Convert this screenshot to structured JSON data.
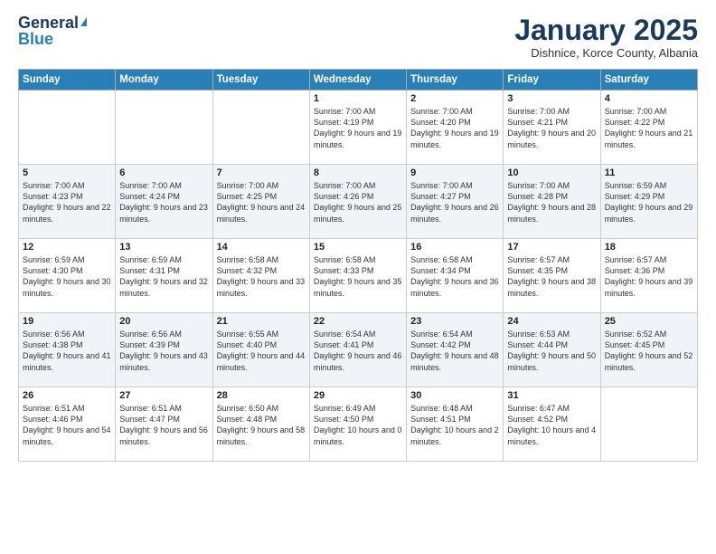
{
  "logo": {
    "general": "General",
    "blue": "Blue"
  },
  "header": {
    "month": "January 2025",
    "location": "Dishnice, Korce County, Albania"
  },
  "weekdays": [
    "Sunday",
    "Monday",
    "Tuesday",
    "Wednesday",
    "Thursday",
    "Friday",
    "Saturday"
  ],
  "weeks": [
    [
      {
        "day": "",
        "sunrise": "",
        "sunset": "",
        "daylight": ""
      },
      {
        "day": "",
        "sunrise": "",
        "sunset": "",
        "daylight": ""
      },
      {
        "day": "",
        "sunrise": "",
        "sunset": "",
        "daylight": ""
      },
      {
        "day": "1",
        "sunrise": "Sunrise: 7:00 AM",
        "sunset": "Sunset: 4:19 PM",
        "daylight": "Daylight: 9 hours and 19 minutes."
      },
      {
        "day": "2",
        "sunrise": "Sunrise: 7:00 AM",
        "sunset": "Sunset: 4:20 PM",
        "daylight": "Daylight: 9 hours and 19 minutes."
      },
      {
        "day": "3",
        "sunrise": "Sunrise: 7:00 AM",
        "sunset": "Sunset: 4:21 PM",
        "daylight": "Daylight: 9 hours and 20 minutes."
      },
      {
        "day": "4",
        "sunrise": "Sunrise: 7:00 AM",
        "sunset": "Sunset: 4:22 PM",
        "daylight": "Daylight: 9 hours and 21 minutes."
      }
    ],
    [
      {
        "day": "5",
        "sunrise": "Sunrise: 7:00 AM",
        "sunset": "Sunset: 4:23 PM",
        "daylight": "Daylight: 9 hours and 22 minutes."
      },
      {
        "day": "6",
        "sunrise": "Sunrise: 7:00 AM",
        "sunset": "Sunset: 4:24 PM",
        "daylight": "Daylight: 9 hours and 23 minutes."
      },
      {
        "day": "7",
        "sunrise": "Sunrise: 7:00 AM",
        "sunset": "Sunset: 4:25 PM",
        "daylight": "Daylight: 9 hours and 24 minutes."
      },
      {
        "day": "8",
        "sunrise": "Sunrise: 7:00 AM",
        "sunset": "Sunset: 4:26 PM",
        "daylight": "Daylight: 9 hours and 25 minutes."
      },
      {
        "day": "9",
        "sunrise": "Sunrise: 7:00 AM",
        "sunset": "Sunset: 4:27 PM",
        "daylight": "Daylight: 9 hours and 26 minutes."
      },
      {
        "day": "10",
        "sunrise": "Sunrise: 7:00 AM",
        "sunset": "Sunset: 4:28 PM",
        "daylight": "Daylight: 9 hours and 28 minutes."
      },
      {
        "day": "11",
        "sunrise": "Sunrise: 6:59 AM",
        "sunset": "Sunset: 4:29 PM",
        "daylight": "Daylight: 9 hours and 29 minutes."
      }
    ],
    [
      {
        "day": "12",
        "sunrise": "Sunrise: 6:59 AM",
        "sunset": "Sunset: 4:30 PM",
        "daylight": "Daylight: 9 hours and 30 minutes."
      },
      {
        "day": "13",
        "sunrise": "Sunrise: 6:59 AM",
        "sunset": "Sunset: 4:31 PM",
        "daylight": "Daylight: 9 hours and 32 minutes."
      },
      {
        "day": "14",
        "sunrise": "Sunrise: 6:58 AM",
        "sunset": "Sunset: 4:32 PM",
        "daylight": "Daylight: 9 hours and 33 minutes."
      },
      {
        "day": "15",
        "sunrise": "Sunrise: 6:58 AM",
        "sunset": "Sunset: 4:33 PM",
        "daylight": "Daylight: 9 hours and 35 minutes."
      },
      {
        "day": "16",
        "sunrise": "Sunrise: 6:58 AM",
        "sunset": "Sunset: 4:34 PM",
        "daylight": "Daylight: 9 hours and 36 minutes."
      },
      {
        "day": "17",
        "sunrise": "Sunrise: 6:57 AM",
        "sunset": "Sunset: 4:35 PM",
        "daylight": "Daylight: 9 hours and 38 minutes."
      },
      {
        "day": "18",
        "sunrise": "Sunrise: 6:57 AM",
        "sunset": "Sunset: 4:36 PM",
        "daylight": "Daylight: 9 hours and 39 minutes."
      }
    ],
    [
      {
        "day": "19",
        "sunrise": "Sunrise: 6:56 AM",
        "sunset": "Sunset: 4:38 PM",
        "daylight": "Daylight: 9 hours and 41 minutes."
      },
      {
        "day": "20",
        "sunrise": "Sunrise: 6:56 AM",
        "sunset": "Sunset: 4:39 PM",
        "daylight": "Daylight: 9 hours and 43 minutes."
      },
      {
        "day": "21",
        "sunrise": "Sunrise: 6:55 AM",
        "sunset": "Sunset: 4:40 PM",
        "daylight": "Daylight: 9 hours and 44 minutes."
      },
      {
        "day": "22",
        "sunrise": "Sunrise: 6:54 AM",
        "sunset": "Sunset: 4:41 PM",
        "daylight": "Daylight: 9 hours and 46 minutes."
      },
      {
        "day": "23",
        "sunrise": "Sunrise: 6:54 AM",
        "sunset": "Sunset: 4:42 PM",
        "daylight": "Daylight: 9 hours and 48 minutes."
      },
      {
        "day": "24",
        "sunrise": "Sunrise: 6:53 AM",
        "sunset": "Sunset: 4:44 PM",
        "daylight": "Daylight: 9 hours and 50 minutes."
      },
      {
        "day": "25",
        "sunrise": "Sunrise: 6:52 AM",
        "sunset": "Sunset: 4:45 PM",
        "daylight": "Daylight: 9 hours and 52 minutes."
      }
    ],
    [
      {
        "day": "26",
        "sunrise": "Sunrise: 6:51 AM",
        "sunset": "Sunset: 4:46 PM",
        "daylight": "Daylight: 9 hours and 54 minutes."
      },
      {
        "day": "27",
        "sunrise": "Sunrise: 6:51 AM",
        "sunset": "Sunset: 4:47 PM",
        "daylight": "Daylight: 9 hours and 56 minutes."
      },
      {
        "day": "28",
        "sunrise": "Sunrise: 6:50 AM",
        "sunset": "Sunset: 4:48 PM",
        "daylight": "Daylight: 9 hours and 58 minutes."
      },
      {
        "day": "29",
        "sunrise": "Sunrise: 6:49 AM",
        "sunset": "Sunset: 4:50 PM",
        "daylight": "Daylight: 10 hours and 0 minutes."
      },
      {
        "day": "30",
        "sunrise": "Sunrise: 6:48 AM",
        "sunset": "Sunset: 4:51 PM",
        "daylight": "Daylight: 10 hours and 2 minutes."
      },
      {
        "day": "31",
        "sunrise": "Sunrise: 6:47 AM",
        "sunset": "Sunset: 4:52 PM",
        "daylight": "Daylight: 10 hours and 4 minutes."
      },
      {
        "day": "",
        "sunrise": "",
        "sunset": "",
        "daylight": ""
      }
    ]
  ]
}
